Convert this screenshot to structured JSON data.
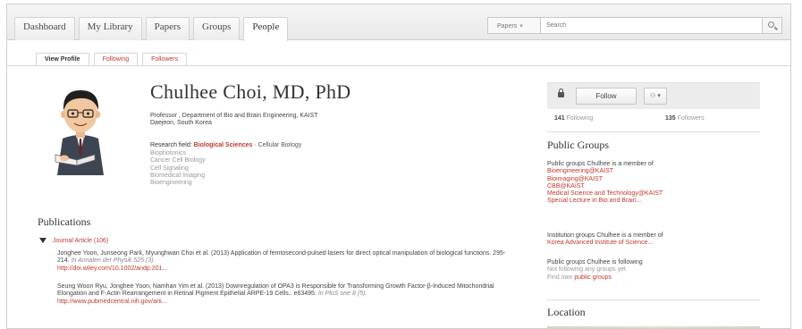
{
  "nav": {
    "tabs": [
      "Dashboard",
      "My Library",
      "Papers",
      "Groups",
      "People"
    ],
    "active_tab": "People",
    "search": {
      "scope": "Papers",
      "placeholder": "Search"
    }
  },
  "subtabs": [
    "View Profile",
    "Following",
    "Followers"
  ],
  "profile": {
    "name": "Chulhee Choi, MD, PhD",
    "position_line1": "Professor , Department of Bio and Brain Engineering, KAIST",
    "position_line2": "Daejeon, South Korea",
    "research_label": "Research field:",
    "research_field": "Biological Sciences",
    "research_sub": "· Cellular Biology",
    "disciplines": [
      "Biophotonics",
      "Cancer Cell Biology",
      "Cell Signaling",
      "Biomedical Imaging",
      "Bioengineering"
    ]
  },
  "publications": {
    "title": "Publications",
    "section": "Journal Article (106)",
    "items": [
      {
        "text": "Jonghee Yoon, Junseong Park, Myunghwan Choi et al. (2013) Application of femtosecond-pulsed lasers for direct optical manipulation of biological functions. 295-214.",
        "venue": "In Annalen der Physik 525 (3).",
        "link": "http://doi.wiley.com/10.1002/andp.201..."
      },
      {
        "text": "Seung Woon Ryu, Jonghee Yoon, Namhan Yim et al. (2013) Downregulation of OPA3 is Responsible for Transforming Growth Factor-β-Induced Mitochondrial Elongation and F-Actin Rearrangement in Retinal Pigment Epithelial ARPE-19 Cells.. e63495.",
        "venue": "In PloS one 8 (5).",
        "link": "http://www.pubmedcentral.nih.gov/arti..."
      }
    ]
  },
  "follow": {
    "button": "Follow",
    "person_button": "⚇ ▾",
    "following_count": "141",
    "following_label": "Following",
    "followers_count": "135",
    "followers_label": "Followers"
  },
  "public_groups": {
    "title": "Public Groups",
    "member_intro": "Public groups Chulhee is a member of",
    "groups": [
      "Bioengineering@KAIST",
      "Bioimaging@KAIST",
      "CBB@KAIST",
      "Medical Science and Technology@KAIST",
      "Special Lecture in Bio and Brain..."
    ],
    "institution_intro": "Institution groups Chulhee is a member of",
    "institution": "Korea Advanced Institute of Science...",
    "following_intro": "Public groups Chulhee is following",
    "following_none": "Not following any groups yet",
    "find_prefix": "Find own",
    "find_link": "public groups"
  },
  "location": {
    "title": "Location"
  },
  "colors": {
    "accent": "#c0392b",
    "tab_bg": "#ececec",
    "follow_box": "#ececec"
  }
}
